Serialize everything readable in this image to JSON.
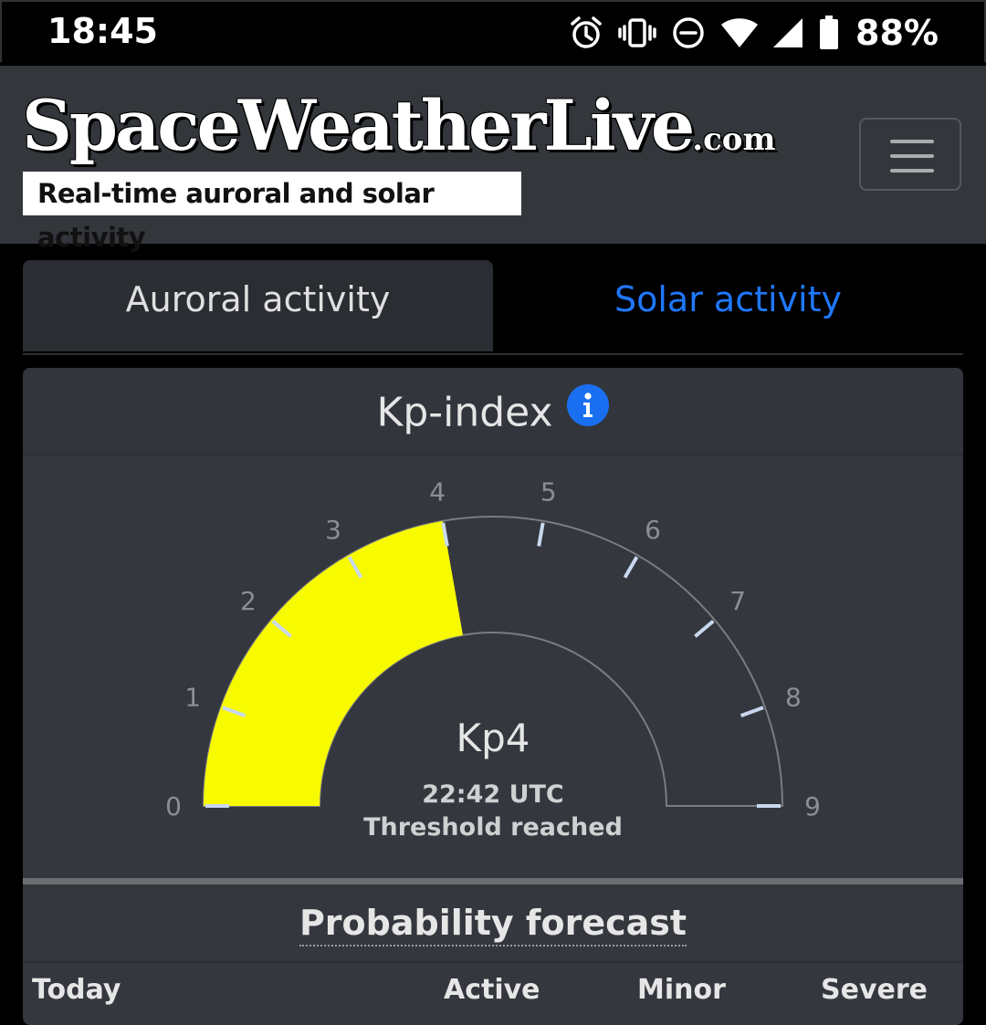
{
  "status_bar": {
    "time": "18:45",
    "battery": "88%",
    "icons": [
      "alarm-icon",
      "vibrate-icon",
      "do-not-disturb-icon",
      "wifi-icon",
      "signal-icon",
      "battery-icon"
    ]
  },
  "header": {
    "logo_main": "SpaceWeatherLive",
    "logo_suffix": ".com",
    "tagline": "Real-time auroral and solar activity",
    "menu_icon": "hamburger-menu-icon"
  },
  "tabs": [
    {
      "label": "Auroral activity",
      "active": true
    },
    {
      "label": "Solar activity",
      "active": false
    }
  ],
  "kp_card": {
    "title": "Kp-index",
    "info_icon": "info-icon",
    "gauge": {
      "min": 0,
      "max": 9,
      "value": 4,
      "fill_color": "#f8fb00",
      "ticks": [
        "0",
        "1",
        "2",
        "3",
        "4",
        "5",
        "6",
        "7",
        "8",
        "9"
      ],
      "value_label": "Kp4",
      "time": "22:42 UTC",
      "status": "Threshold reached"
    }
  },
  "forecast": {
    "title": "Probability forecast",
    "columns": [
      "Today",
      "Active",
      "Minor",
      "Severe"
    ]
  },
  "colors": {
    "accent_link": "#1f78ff",
    "info_badge": "#1a6ff0",
    "gauge_fill": "#f8fb00"
  }
}
